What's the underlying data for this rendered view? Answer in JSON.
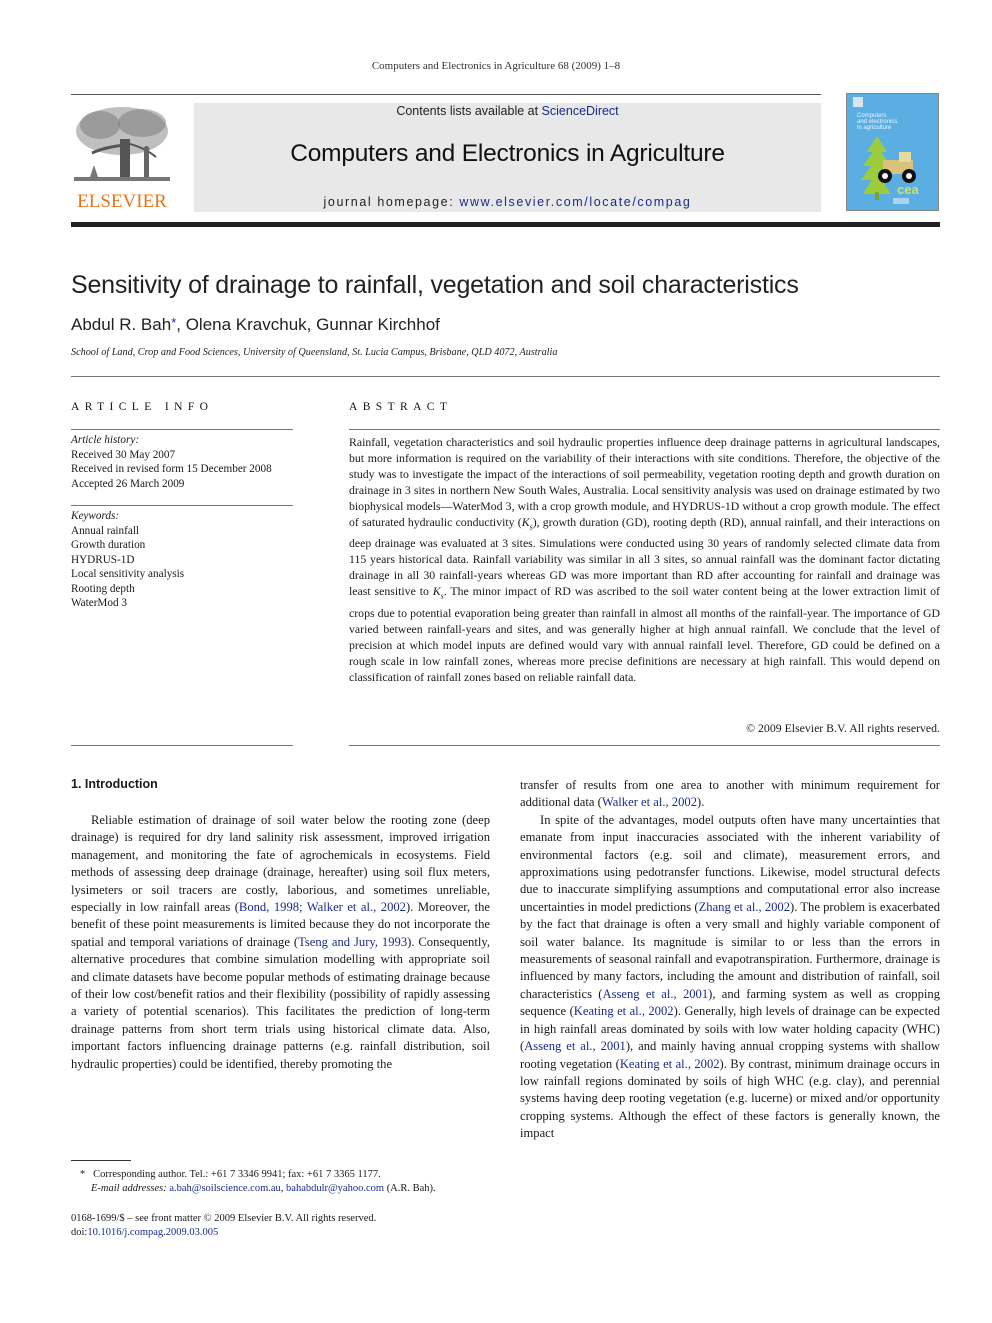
{
  "running_head": "Computers and Electronics in Agriculture 68 (2009) 1–8",
  "banner": {
    "contents_prefix": "Contents lists available at ",
    "contents_link": "ScienceDirect",
    "journal_title": "Computers and Electronics in Agriculture",
    "homepage_prefix": "journal homepage: ",
    "homepage_link": "www.elsevier.com/locate/compag"
  },
  "publisher_logo": {
    "icon": "elsevier-tree-logo",
    "wordmark": "ELSEVIER",
    "color": "#e8751a"
  },
  "cover": {
    "icon": "journal-cover-thumbnail",
    "lines": [
      "Computers",
      "and electronics",
      "in agriculture"
    ],
    "badge": "cea",
    "color": "#5aaee2"
  },
  "article": {
    "title": "Sensitivity of drainage to rainfall, vegetation and soil characteristics",
    "authors": [
      {
        "name": "Abdul R. Bah",
        "mark": "*",
        "sep": ", "
      },
      {
        "name": "Olena Kravchuk",
        "mark": "",
        "sep": ", "
      },
      {
        "name": "Gunnar Kirchhof",
        "mark": "",
        "sep": ""
      }
    ],
    "affiliation": "School of Land, Crop and Food Sciences, University of Queensland, St. Lucia Campus, Brisbane, QLD 4072, Australia"
  },
  "article_info": {
    "heading": "ARTICLE INFO",
    "history_label": "Article history:",
    "history": [
      "Received 30 May 2007",
      "Received in revised form 15 December 2008",
      "Accepted 26 March 2009"
    ],
    "keywords_label": "Keywords:",
    "keywords": [
      "Annual rainfall",
      "Growth duration",
      "HYDRUS-1D",
      "Local sensitivity analysis",
      "Rooting depth",
      "WaterMod 3"
    ]
  },
  "abstract": {
    "heading": "ABSTRACT",
    "text_1": "Rainfall, vegetation characteristics and soil hydraulic properties influence deep drainage patterns in agricultural landscapes, but more information is required on the variability of their interactions with site conditions. Therefore, the objective of the study was to investigate the impact of the interactions of soil permeability, vegetation rooting depth and growth duration on drainage in 3 sites in northern New South Wales, Australia. Local sensitivity analysis was used on drainage estimated by two biophysical models—WaterMod 3, with a crop growth module, and HYDRUS-1D without a crop growth module. The effect of saturated hydraulic conductivity (",
    "ks_1": "K",
    "ks_sub": "s",
    "text_2": "), growth duration (GD), rooting depth (RD), annual rainfall, and their interactions on deep drainage was evaluated at 3 sites. Simulations were conducted using 30 years of randomly selected climate data from 115 years historical data. Rainfall variability was similar in all 3 sites, so annual rainfall was the dominant factor dictating drainage in all 30 rainfall-years whereas GD was more important than RD after accounting for rainfall and drainage was least sensitive to ",
    "text_3": ". The minor impact of RD was ascribed to the soil water content being at the lower extraction limit of crops due to potential evaporation being greater than rainfall in almost all months of the rainfall-year. The importance of GD varied between rainfall-years and sites, and was generally higher at high annual rainfall. We conclude that the level of precision at which model inputs are defined would vary with annual rainfall level. Therefore, GD could be defined on a rough scale in low rainfall zones, whereas more precise definitions are necessary at high rainfall. This would depend on classification of rainfall zones based on reliable rainfall data.",
    "copyright": "© 2009 Elsevier B.V. All rights reserved."
  },
  "introduction": {
    "heading": "1.  Introduction",
    "left_p1": [
      {
        "t": "Reliable estimation of drainage of soil water below the rooting zone (deep drainage) is required for dry land salinity risk assessment, improved irrigation management, and monitoring the fate of agrochemicals in ecosystems. Field methods of assessing deep drainage (drainage, hereafter) using soil flux meters, lysimeters or soil tracers are costly, laborious, and sometimes unreliable, especially in low rainfall areas ("
      },
      {
        "link": "Bond, 1998; Walker et al., 2002"
      },
      {
        "t": "). Moreover, the benefit of these point measurements is limited because they do not incorporate the spatial and temporal variations of drainage ("
      },
      {
        "link": "Tseng and Jury, 1993"
      },
      {
        "t": "). Consequently, alternative procedures that combine simulation modelling with appropriate soil and climate datasets have become popular methods of estimating drainage because of their low cost/benefit ratios and their flexibility (possibility of rapidly assessing a variety of potential scenarios). This facilitates the prediction of long-term drainage patterns from short term trials using historical climate data. Also, important factors influencing drainage patterns (e.g. rainfall distribution, soil hydraulic properties) could be identified, thereby promoting the"
      }
    ],
    "right_p0": [
      {
        "t": "transfer of results from one area to another with minimum requirement for additional data ("
      },
      {
        "link": "Walker et al., 2002"
      },
      {
        "t": ")."
      }
    ],
    "right_p1": [
      {
        "t": "In spite of the advantages, model outputs often have many uncertainties that emanate from input inaccuracies associated with the inherent variability of environmental factors (e.g. soil and climate), measurement errors, and approximations using pedotransfer functions. Likewise, model structural defects due to inaccurate simplifying assumptions and computational error also increase uncertainties in model predictions ("
      },
      {
        "link": "Zhang et al., 2002"
      },
      {
        "t": "). The problem is exacerbated by the fact that drainage is often a very small and highly variable component of soil water balance. Its magnitude is similar to or less than the errors in measurements of seasonal rainfall and evapotranspiration. Furthermore, drainage is influenced by many factors, including the amount and distribution of rainfall, soil characteristics ("
      },
      {
        "link": "Asseng et al., 2001"
      },
      {
        "t": "), and farming system as well as cropping sequence ("
      },
      {
        "link": "Keating et al., 2002"
      },
      {
        "t": "). Generally, high levels of drainage can be expected in high rainfall areas dominated by soils with low water holding capacity (WHC) ("
      },
      {
        "link": "Asseng et al., 2001"
      },
      {
        "t": "), and mainly having annual cropping systems with shallow rooting vegetation ("
      },
      {
        "link": "Keating et al., 2002"
      },
      {
        "t": "). By contrast, minimum drainage occurs in low rainfall regions dominated by soils of high WHC (e.g. clay), and perennial systems having deep rooting vegetation (e.g. lucerne) or mixed and/or opportunity cropping systems. Although the effect of these factors is generally known, the impact"
      }
    ]
  },
  "footnotes": {
    "star": "*",
    "corresponding": "Corresponding author. Tel.: +61 7 3346 9941; fax: +61 7 3365 1177.",
    "email_label": "E-mail addresses:",
    "email_1": "a.bah@soilscience.com.au",
    "email_sep": ", ",
    "email_2": "bahabdulr@yahoo.com",
    "email_suffix": " (A.R. Bah).",
    "issn_line": "0168-1699/$ – see front matter © 2009 Elsevier B.V. All rights reserved.",
    "doi_prefix": "doi:",
    "doi": "10.1016/j.compag.2009.03.005"
  }
}
